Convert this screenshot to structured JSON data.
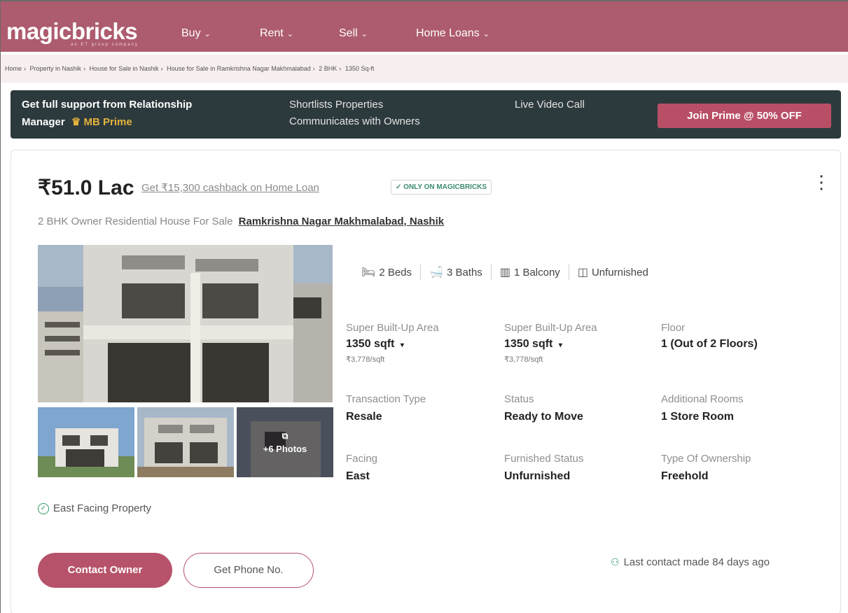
{
  "brand": {
    "logo": "magicbricks",
    "tagline": "an ET group company"
  },
  "nav": {
    "items": [
      {
        "label": "Buy"
      },
      {
        "label": "Rent"
      },
      {
        "label": "Sell"
      },
      {
        "label": "Home Loans"
      }
    ]
  },
  "breadcrumb": [
    "Home",
    "Property in Nashik",
    "House for Sale in Nashik",
    "House for Sale in Ramkrishna Nagar Makhmalabad",
    "2 BHK",
    "1350 Sq-ft"
  ],
  "prime": {
    "line1": "Get full support from Relationship",
    "line2_prefix": "Manager",
    "badge": "MB Prime",
    "features": [
      "Shortlists Properties",
      "Communicates with Owners",
      "Live Video Call"
    ],
    "cta": "Join Prime @ 50% OFF"
  },
  "listing": {
    "price": "₹51.0 Lac",
    "cashback": "Get ₹15,300 cashback on Home Loan",
    "badge": "ONLY ON MAGICBRICKS",
    "title_prefix": "2 BHK Owner Residential House For Sale",
    "location": "Ramkrishna Nagar Makhmalabad, Nashik",
    "photo_more": "+6 Photos",
    "amenities": [
      {
        "icon": "bed-icon",
        "label": "2 Beds"
      },
      {
        "icon": "bath-icon",
        "label": "3 Baths"
      },
      {
        "icon": "balcony-icon",
        "label": "1 Balcony"
      },
      {
        "icon": "furnishing-icon",
        "label": "Unfurnished"
      }
    ],
    "details": [
      {
        "label": "Super Built-Up Area",
        "value": "1350 sqft",
        "sub": "₹3,778/sqft"
      },
      {
        "label": "Super Built-Up Area",
        "value": "1350 sqft",
        "sub": "₹3,778/sqft"
      },
      {
        "label": "Floor",
        "value": "1 (Out of 2 Floors)"
      },
      {
        "label": "Transaction Type",
        "value": "Resale"
      },
      {
        "label": "Status",
        "value": "Ready to Move"
      },
      {
        "label": "Additional Rooms",
        "value": "1 Store Room"
      },
      {
        "label": "Facing",
        "value": "East"
      },
      {
        "label": "Furnished Status",
        "value": "Unfurnished"
      },
      {
        "label": "Type Of Ownership",
        "value": "Freehold"
      }
    ],
    "highlight": "East Facing Property",
    "contact_button": "Contact Owner",
    "phone_button": "Get Phone No.",
    "last_contact": "Last contact made 84 days ago"
  },
  "colors": {
    "brand": "#ad5b6e",
    "cta": "#b6536a",
    "prime_bg": "#2d3a3d",
    "gold": "#e3b33d",
    "success": "#2f9a66"
  }
}
